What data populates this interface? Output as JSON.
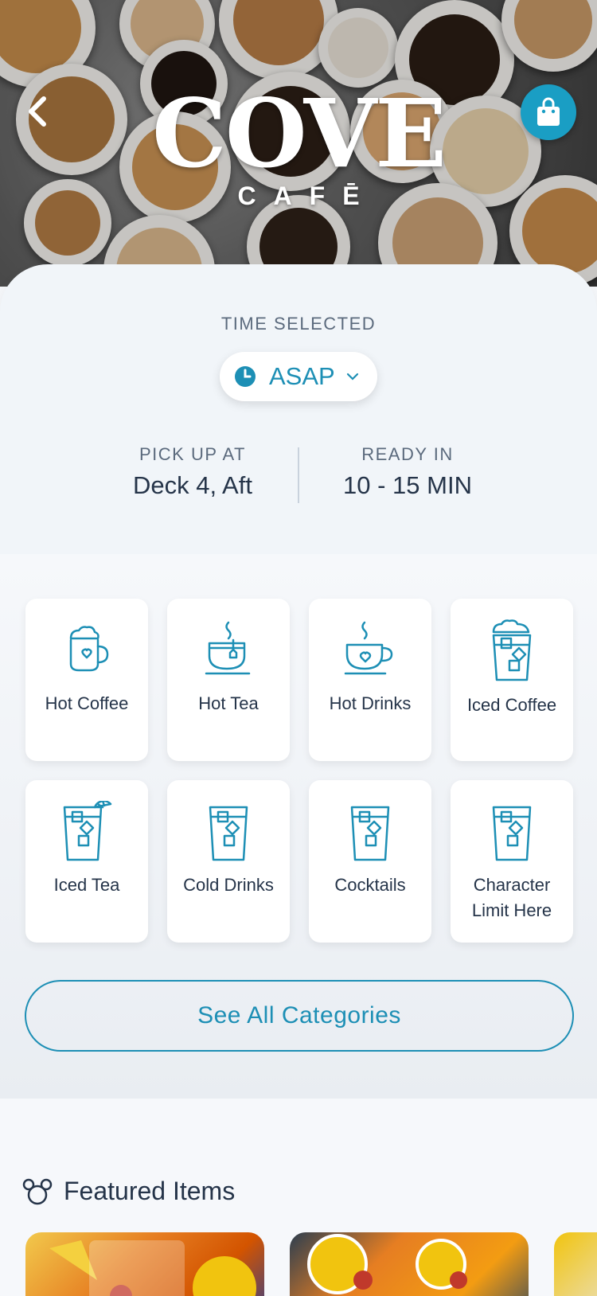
{
  "header": {
    "logo_main": "COVE",
    "logo_sub": "CAFĒ"
  },
  "time": {
    "label": "TIME SELECTED",
    "value": "ASAP"
  },
  "pickup": {
    "label": "PICK UP AT",
    "value": "Deck 4, Aft"
  },
  "ready": {
    "label": "READY IN",
    "value": "10 - 15 MIN"
  },
  "categories": [
    {
      "label": "Hot Coffee",
      "icon": "hot-coffee-icon"
    },
    {
      "label": "Hot Tea",
      "icon": "hot-tea-icon"
    },
    {
      "label": "Hot Drinks",
      "icon": "hot-drinks-icon"
    },
    {
      "label": "Iced Coffee",
      "icon": "iced-coffee-icon"
    },
    {
      "label": "Iced Tea",
      "icon": "iced-tea-icon"
    },
    {
      "label": "Cold Drinks",
      "icon": "cold-drinks-icon"
    },
    {
      "label": "Cocktails",
      "icon": "cocktails-icon"
    },
    {
      "label": "Character Limit Here",
      "icon": "cup-icon"
    }
  ],
  "see_all_label": "See All Categories",
  "featured": {
    "title": "Featured Items"
  },
  "colors": {
    "accent": "#1d8fb5",
    "bag_button": "#1a9ec4",
    "text_dark": "#253449",
    "text_muted": "#5b6a7d"
  }
}
